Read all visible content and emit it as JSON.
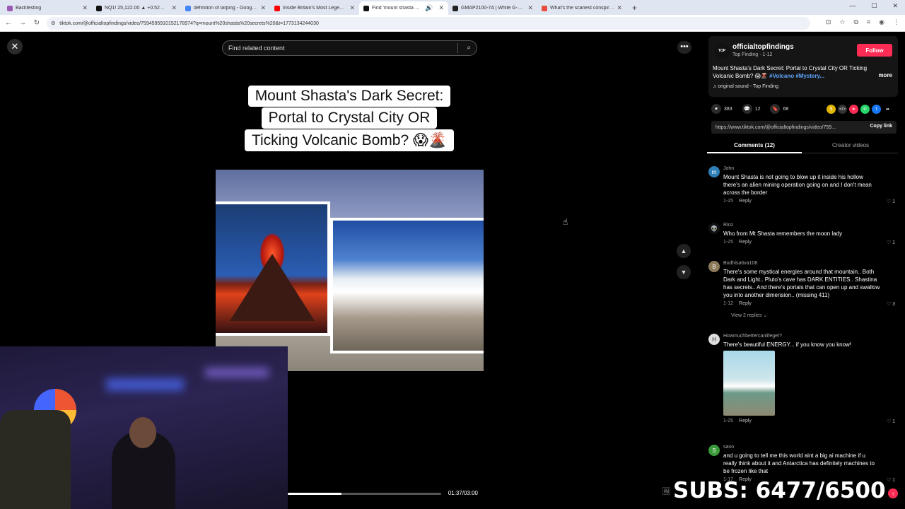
{
  "browser": {
    "tabs": [
      {
        "title": "Backtesting",
        "color": "#9b59b6",
        "active": false
      },
      {
        "title": "NQ1! 25,122.00 ▲ +0.52% Unn",
        "color": "#111111",
        "active": false
      },
      {
        "title": "definition of larping - Google S",
        "color": "#4285f4",
        "active": false
      },
      {
        "title": "Inside Britain's Most Legendary",
        "color": "#ff0000",
        "active": false
      },
      {
        "title": "Find 'mount shasta secrets'",
        "color": "#111111",
        "active": true
      },
      {
        "title": "GMAP2100-7A | White G-SHOC",
        "color": "#222222",
        "active": false
      },
      {
        "title": "What's the scariest conspiracy",
        "color": "#e74c3c",
        "active": false
      }
    ],
    "url": "tiktok.com/@officialtopfindings/video/7594595910152178974?q=mount%20shasta%20secrets%20&t=1773134244030"
  },
  "video": {
    "search_placeholder": "Find related content",
    "caption_lines": [
      "Mount Shasta's Dark Secret:",
      "Portal to Crystal City OR",
      "Ticking Volcanic Bomb? 😱🌋"
    ],
    "time": "01:37/03:00",
    "progress": 0.35
  },
  "post": {
    "avatar_text": "TOP",
    "username": "officialtopfindings",
    "subline": "Top Finding · 1-12",
    "follow_label": "Follow",
    "description": "Mount Shasta's Dark Secret: Portal to Crystal City OR Ticking Volcanic Bomb? 😱🌋",
    "tags": "#Volcano #Mystery...",
    "more_label": "more",
    "sound": "♫  original sound - Top Finding",
    "likes": "383",
    "comments": "12",
    "saves": "68",
    "link": "https://www.tiktok.com/@officialtopfindings/video/759...",
    "copy_label": "Copy link",
    "tab_comments": "Comments (12)",
    "tab_creator": "Creator videos"
  },
  "comments": [
    {
      "name": "John",
      "initial": "m",
      "color": "#2e7fb8",
      "text": "Mount Shasta is not going to blow up it inside his hollow there's an alien mining operation going on and I don't mean across the border",
      "date": "1-25",
      "reply": "Reply",
      "likes": "1"
    },
    {
      "name": "Rico",
      "initial": "👽",
      "color": "#111111",
      "text": "Who from Mt Shasta remembers the moon lady",
      "date": "1-25",
      "reply": "Reply",
      "likes": "1"
    },
    {
      "name": "Bodhisattva108",
      "initial": "B",
      "color": "#8a7a5a",
      "text": "There's some mystical energies around that mountain.. Both Dark and Light.. Pluto's cave has DARK ENTITIES.. Shastina has secrets.. And there's portals that can open up and swallow you into another dimension.. (missing 411)",
      "date": "1-12",
      "reply": "Reply",
      "likes": "3",
      "view_replies": "View 2 replies ⌄"
    },
    {
      "name": "Howmuchbettercanlifeget?",
      "initial": "H",
      "color": "#dddddd",
      "text": "There's beautiful ENERGY... if you know you know!",
      "date": "1-25",
      "reply": "Reply",
      "likes": "1"
    },
    {
      "name": "sano",
      "initial": "S",
      "color": "#3a9a3a",
      "text": "and u going to tell me this world aint a big ai machine if u really think about it and Antarctica has definitely machines to be frozen like that",
      "date": "1-17",
      "reply": "Reply",
      "likes": "1"
    }
  ],
  "overlay": {
    "subs": "SUBS: 6477/6500"
  },
  "colors": {
    "accent": "#fe2c55",
    "hashtag": "#5ea7ff"
  }
}
